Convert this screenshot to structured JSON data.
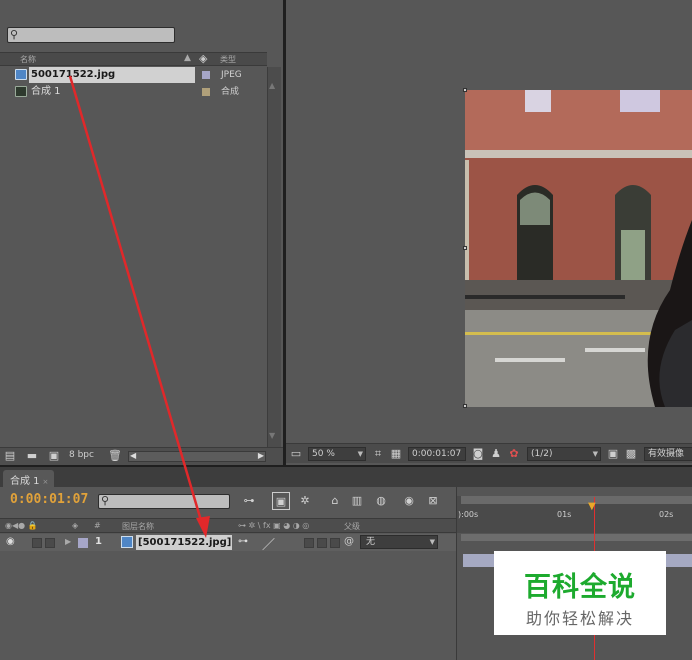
{
  "project_panel": {
    "search_placeholder": "",
    "col_name": "名称",
    "col_type": "类型",
    "items": [
      {
        "name": "500171522.jpg",
        "type": "JPEG",
        "swatch": "#a6a6c8",
        "icon": "image-file-icon",
        "selected": true
      },
      {
        "name": "合成 1",
        "type": "合成",
        "swatch": "#b0a07a",
        "icon": "composition-icon",
        "selected": false
      }
    ],
    "bpc_label": "8 bpc"
  },
  "viewer": {
    "zoom": "50 %",
    "timecode": "0:00:01:07",
    "resolution": "(1/2)",
    "right_label": "有效摄像"
  },
  "timeline": {
    "tab_label": "合成 1",
    "current_time": "0:00:01:07",
    "col_layer_name": "图层名称",
    "col_parent": "父级",
    "col_number": "#",
    "layer": {
      "index": "1",
      "name": "[500171522.jpg]",
      "parent": "无",
      "label_color": "#a6a6c8"
    },
    "ruler": [
      "):00s",
      "01s",
      "02s"
    ]
  },
  "watermark": {
    "title": "百科全说",
    "subtitle": "助你轻松解决"
  }
}
